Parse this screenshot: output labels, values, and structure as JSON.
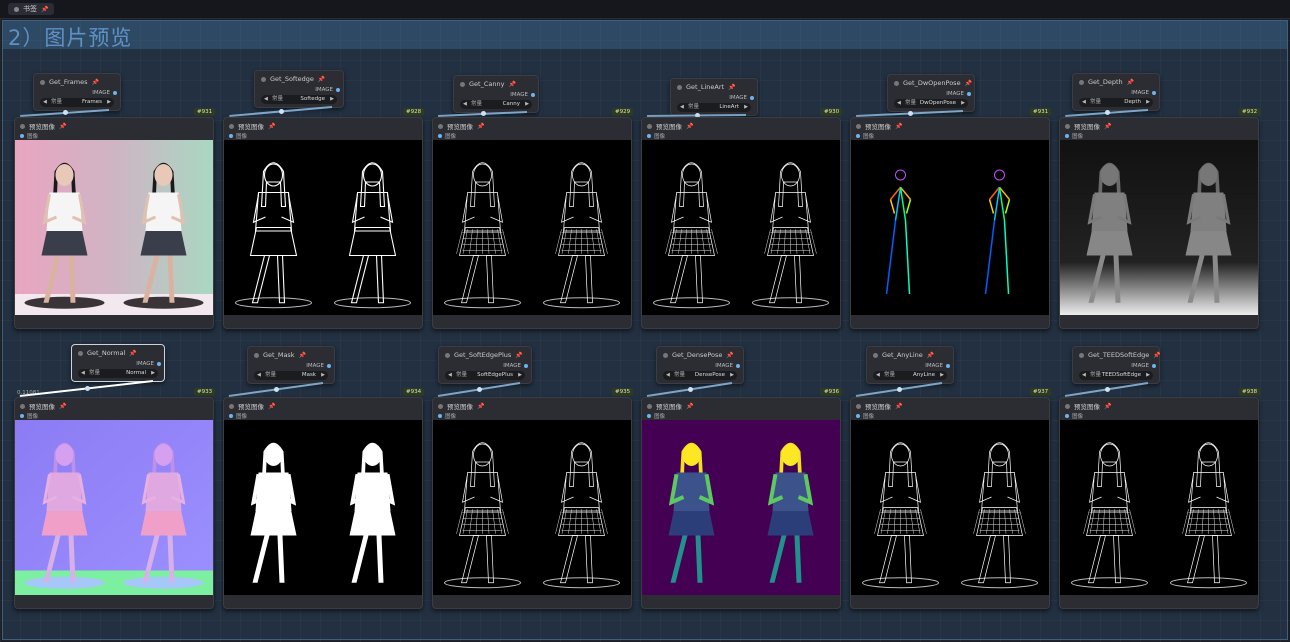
{
  "bookmark": {
    "label": "书签"
  },
  "group": {
    "title": "2）图片预览"
  },
  "labels": {
    "output_type": "IMAGE",
    "widget_name": "常量",
    "input_name": "图像",
    "preview_title": "预览图像"
  },
  "floating_value": "0.11081",
  "top_row": [
    {
      "get_title": "Get_Frames",
      "value": "Frames",
      "id": "#931"
    },
    {
      "get_title": "Get_Softedge",
      "value": "Softedge",
      "id": "#928"
    },
    {
      "get_title": "Get_Canny",
      "value": "Canny",
      "id": "#929"
    },
    {
      "get_title": "Get_LineArt",
      "value": "LineArt",
      "id": "#930"
    },
    {
      "get_title": "Get_DwOpenPose",
      "value": "DwOpenPose",
      "id": "#931"
    },
    {
      "get_title": "Get_Depth",
      "value": "Depth",
      "id": "#932"
    }
  ],
  "bottom_row": [
    {
      "get_title": "Get_Normal",
      "value": "Normal",
      "id": "#933"
    },
    {
      "get_title": "Get_Mask",
      "value": "Mask",
      "id": "#934"
    },
    {
      "get_title": "Get_SoftEdgePlus",
      "value": "SoftEdgePlus",
      "id": "#935"
    },
    {
      "get_title": "Get_DensePose",
      "value": "DensePose",
      "id": "#936"
    },
    {
      "get_title": "Get_AnyLine",
      "value": "AnyLine",
      "id": "#937"
    },
    {
      "get_title": "Get_TEEDSoftEdge",
      "value": "TEEDSoftEdge",
      "id": "#938"
    }
  ]
}
